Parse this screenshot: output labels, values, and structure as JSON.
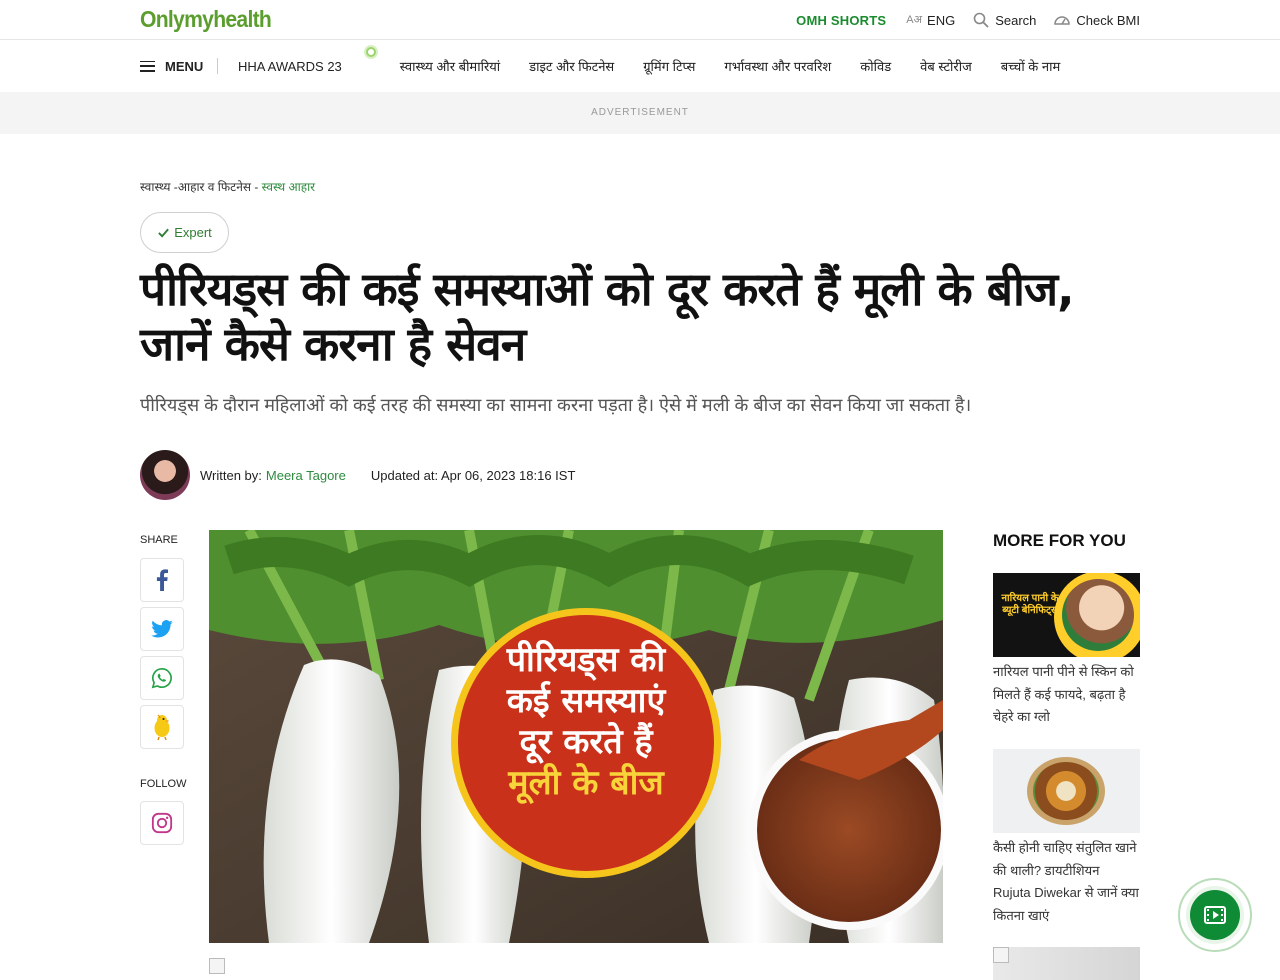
{
  "header": {
    "logo": "Onlymyhealth",
    "shorts": "OMH SHORTS",
    "lang_glyph": "Aअ",
    "lang": "ENG",
    "search": "Search",
    "bmi": "Check BMI"
  },
  "nav": {
    "menu": "MENU",
    "items": [
      "HHA AWARDS 23",
      "स्वास्थ्य और बीमारियां",
      "डाइट और फिटनेस",
      "ग्रूमिंग टिप्स",
      "गर्भावस्था और परवरिश",
      "कोविड",
      "वेब स्टोरीज",
      "बच्चों के नाम"
    ]
  },
  "ad": {
    "label": "ADVERTISEMENT"
  },
  "breadcrumb": {
    "part1": "स्वास्थ्य -",
    "part2": "आहार व फिटनेस -",
    "active": "स्वस्थ आहार"
  },
  "expert_badge": "Expert",
  "article": {
    "headline": "पीरियड्स की कई समस्याओं को दूर करते हैं मूली के बीज, जानें कैसे करना है सेवन",
    "subhead": "पीरियड्स के दौरान महिलाओं को कई तरह की समस्या का सामना करना पड़ता है। ऐसे में मली के बीज का सेवन किया जा सकता है।",
    "written_by": "Written by:",
    "author": "Meera Tagore",
    "updated": "Updated at: Apr 06, 2023 18:16 IST",
    "hero_text": [
      "पीरियड्स की",
      "कई समस्याएं",
      "दूर करते हैं",
      "मूली के बीज"
    ]
  },
  "share": {
    "label": "SHARE",
    "follow": "FOLLOW"
  },
  "sidebar": {
    "title": "MORE FOR YOU",
    "cards": [
      {
        "img_text": "नारियल पानी के ब्यूटी बेनिफिट्स",
        "title": "नारियल पानी पीने से स्किन को मिलते हैं कई फायदे, बढ़ता है चेहरे का ग्लो"
      },
      {
        "title": "कैसी होनी चाहिए संतुलित खाने की थाली? डायटीशियन Rujuta Diwekar से जानें क्या कितना खाएं"
      }
    ]
  },
  "colors": {
    "brand": "#5c9e2e",
    "link": "#2e8b3e",
    "float_button": "#0f8a35"
  }
}
